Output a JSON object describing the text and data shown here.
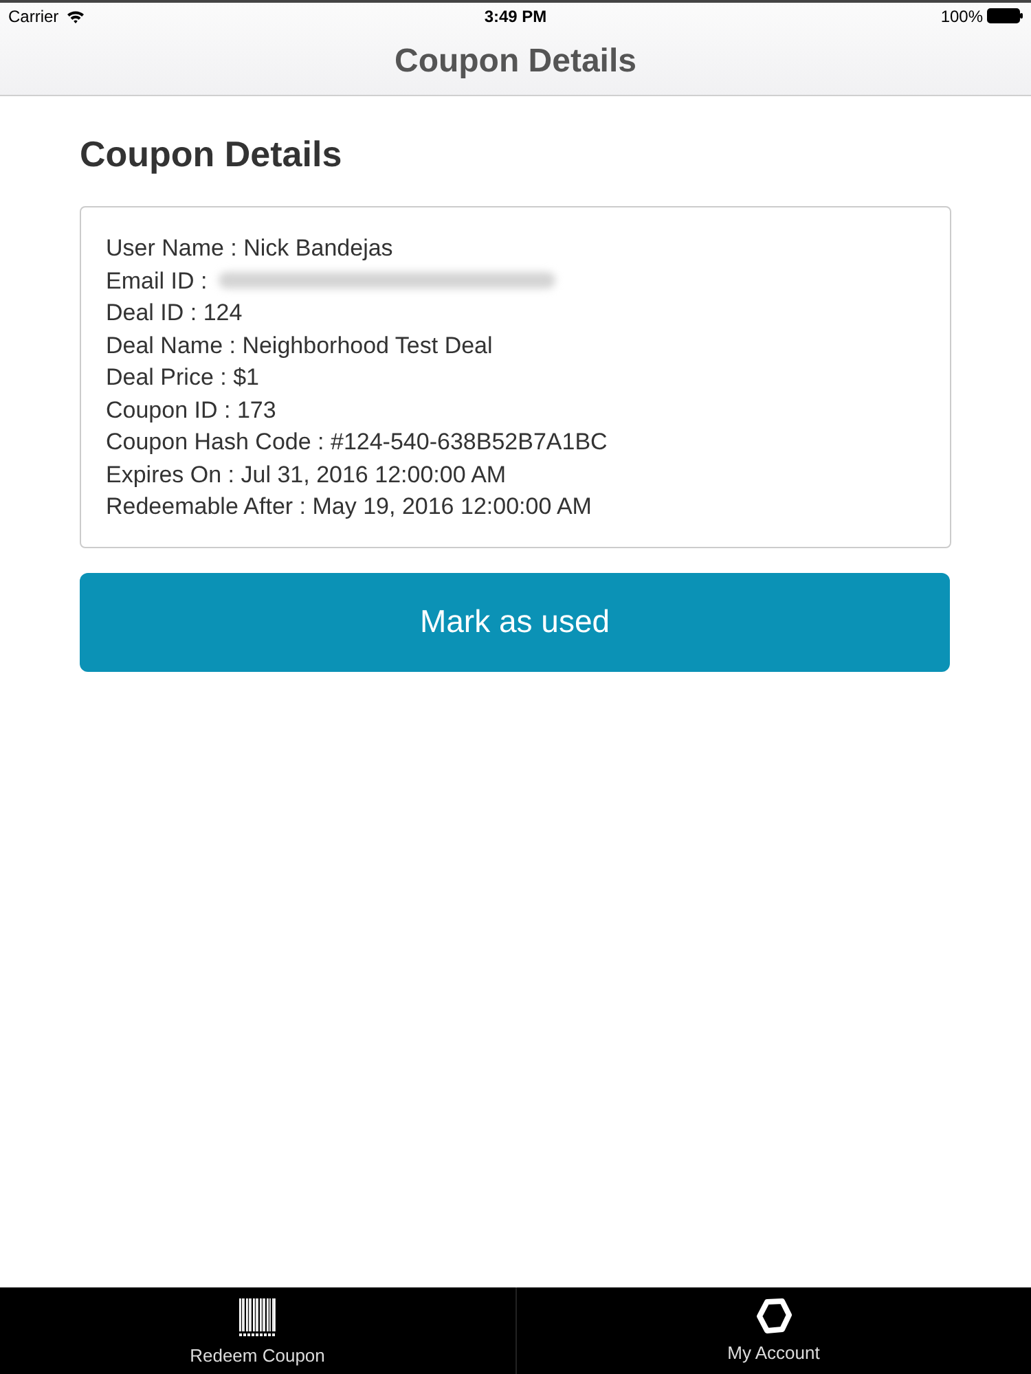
{
  "status_bar": {
    "carrier": "Carrier",
    "time": "3:49 PM",
    "battery": "100%"
  },
  "nav_bar": {
    "title": "Coupon Details"
  },
  "heading": "Coupon Details",
  "details": [
    {
      "kind": "text",
      "text": "User Name : Nick Bandejas"
    },
    {
      "kind": "redacted",
      "text": "Email ID :"
    },
    {
      "kind": "text",
      "text": "Deal ID : 124"
    },
    {
      "kind": "text",
      "text": "Deal Name : Neighborhood Test Deal"
    },
    {
      "kind": "text",
      "text": "Deal Price : $1"
    },
    {
      "kind": "text",
      "text": "Coupon ID : 173"
    },
    {
      "kind": "text",
      "text": "Coupon Hash Code : #124-540-638B52B7A1BC"
    },
    {
      "kind": "text",
      "text": "Expires On : Jul 31, 2016 12:00:00 AM"
    },
    {
      "kind": "text",
      "text": "Redeemable After : May 19, 2016 12:00:00 AM"
    }
  ],
  "action_button": "Mark as used",
  "tab_bar": [
    {
      "kind": "barcode",
      "label": "Redeem Coupon"
    },
    {
      "kind": "hexagon",
      "label": "My Account"
    }
  ]
}
